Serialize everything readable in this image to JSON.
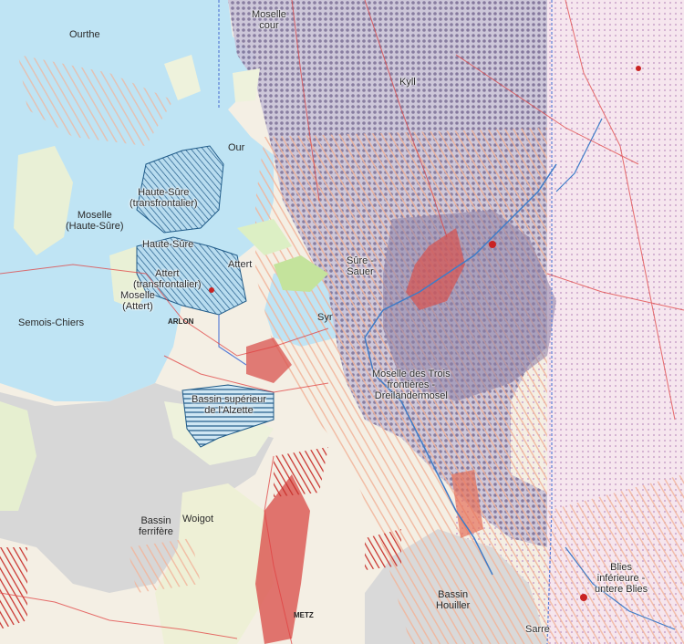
{
  "map": {
    "colors": {
      "water": "#bfe4f4",
      "land": "#f4efe4",
      "grey_zone": "#d8d8d8",
      "dotted_purple": "#8a7fa8",
      "hatch_orange": "#f2b49a",
      "hatch_blue": "#3a8fc0",
      "red_area": "#d9534f",
      "green_forest": "#bfe39a",
      "roads": "#e04040",
      "border_blue": "#5b7fd6"
    },
    "labels": {
      "ourthe": "Ourthe",
      "moselle_cour": "Moselle\ncour",
      "kyll": "Kyll",
      "our": "Our",
      "haute_sure_trans": "Haute-Sûre\n(transfrontalier)",
      "moselle_haute_sure": "Moselle\n(Haute-Sûre)",
      "haute_sure": "Haute-Sûre",
      "attert_trans": "Attert\n(transfrontalier)",
      "attert": "Attert",
      "moselle_attert": "Moselle\n(Attert)",
      "sure_sauer": "Sûre -\nSauer",
      "semois_chiers": "Semois-Chiers",
      "syr": "Syr",
      "arlon": "ARLON",
      "moselle_trois_frontieres": "Moselle des Trois\nfrontières -\nDreiländermosel",
      "bassin_alzette": "Bassin supérieur\nde l'Alzette",
      "bassin_ferrifere": "Bassin\nferrifère",
      "woigot": "Woigot",
      "bassin_houiller": "Bassin\nHouiller",
      "blies": "Blies\ninférieure -\nuntere Blies",
      "metz": "METZ",
      "sarre": "Sarre"
    }
  }
}
